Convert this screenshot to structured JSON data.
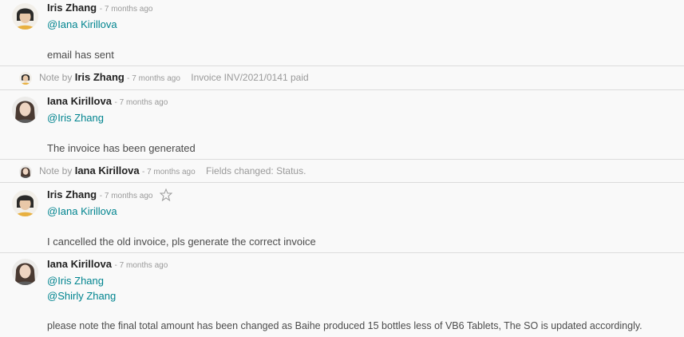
{
  "messages": [
    {
      "author": "Iris Zhang",
      "date": "- 7 months ago",
      "mentions": [
        "@Iana Kirillova"
      ],
      "body": "email has sent"
    },
    {
      "author": "Iana Kirillova",
      "date": "- 7 months ago",
      "mentions": [
        "@Iris Zhang"
      ],
      "body": "The invoice has been generated"
    },
    {
      "author": "Iris Zhang",
      "date": "- 7 months ago",
      "mentions": [
        "@Iana Kirillova"
      ],
      "body": "I cancelled the old invoice, pls generate the correct invoice"
    },
    {
      "author": "Iana Kirillova",
      "date": "- 7 months ago",
      "mentions": [
        "@Iris Zhang",
        "@Shirly Zhang"
      ],
      "body": "please note the final total amount has been changed as Baihe produced 15 bottles less of VB6 Tablets, The SO is updated accordingly."
    }
  ],
  "notes": [
    {
      "prefix": "Note by",
      "author": "Iris Zhang",
      "date": "- 7 months ago",
      "text": "Invoice INV/2021/0141 paid"
    },
    {
      "prefix": "Note by",
      "author": "Iana Kirillova",
      "date": "- 7 months ago",
      "text": "Fields changed: Status."
    }
  ],
  "icons": {
    "star": "star-outline-icon"
  },
  "colors": {
    "mention": "#00848f",
    "background": "#f9f9f9",
    "divider": "#dcdcdc"
  }
}
